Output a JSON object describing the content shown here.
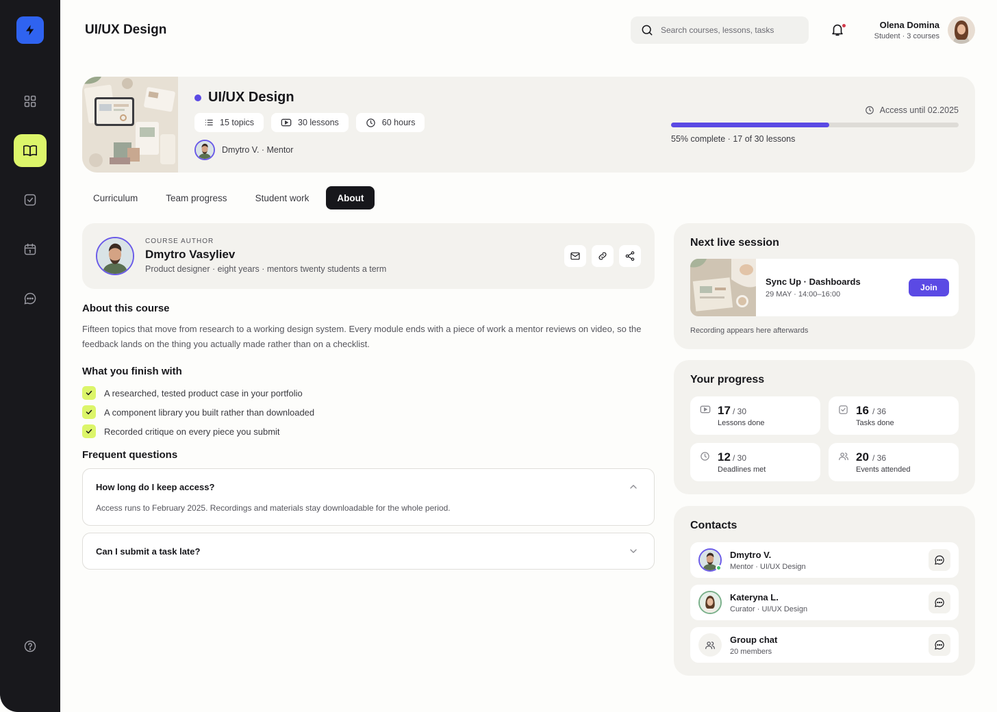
{
  "header": {
    "title": "UI/UX Design",
    "search_placeholder": "Search courses, lessons, tasks",
    "user_name": "Olena Domina",
    "user_sub": "Student · 3 courses"
  },
  "course": {
    "title": "UI/UX Design",
    "topics": "15 topics",
    "lessons": "30 lessons",
    "hours": "60 hours",
    "mentor": "Dmytro V. · Mentor",
    "access": "Access until 02.2025",
    "progress_fraction": 0.55,
    "progress_text": "55% complete · 17 of 30 lessons"
  },
  "tabs": [
    {
      "label": "Curriculum"
    },
    {
      "label": "Team progress"
    },
    {
      "label": "Student work"
    },
    {
      "label": "About",
      "active": true
    }
  ],
  "author": {
    "kicker": "COURSE AUTHOR",
    "name": "Dmytro Vasyliev",
    "desc": "Product designer · eight years · mentors twenty students a term"
  },
  "about": {
    "heading": "About this course",
    "body": "Fifteen topics that move from research to a working design system. Every module ends with a piece of work a mentor reviews on video, so the feedback lands on the thing you actually made rather than on a checklist."
  },
  "finish": {
    "heading": "What you finish with",
    "items": [
      "A researched, tested product case in your portfolio",
      "A component library you built rather than downloaded",
      "Recorded critique on every piece you submit"
    ]
  },
  "faq": {
    "heading": "Frequent questions",
    "items": [
      {
        "q": "How long do I keep access?",
        "a": "Access runs to February 2025. Recordings and materials stay downloadable for the whole period."
      },
      {
        "q": "Can I submit a task late?",
        "a": ""
      }
    ]
  },
  "session": {
    "heading": "Next live session",
    "name": "Sync Up · Dashboards",
    "time": "29 MAY · 14:00–16:00",
    "join": "Join",
    "note": "Recording appears here afterwards"
  },
  "progress": {
    "heading": "Your progress",
    "stats": [
      {
        "value": "17",
        "total": "/ 30",
        "label": "Lessons done",
        "icon": "video-icon"
      },
      {
        "value": "16",
        "total": "/ 36",
        "label": "Tasks done",
        "icon": "checkbox-icon"
      },
      {
        "value": "12",
        "total": "/ 30",
        "label": "Deadlines met",
        "icon": "clock-icon"
      },
      {
        "value": "20",
        "total": "/ 36",
        "label": "Events attended",
        "icon": "people-icon"
      }
    ]
  },
  "contacts": {
    "heading": "Contacts",
    "items": [
      {
        "name": "Dmytro V.",
        "role": "Mentor · UI/UX Design"
      },
      {
        "name": "Kateryna L.",
        "role": "Curator · UI/UX Design"
      },
      {
        "name": "Group chat",
        "role": "20 members"
      }
    ]
  },
  "colors": {
    "sidebar": "#18181c",
    "accent_lime": "#dcf56a",
    "accent_violet": "#5b4ae4",
    "logo_blue": "#2f63f0"
  }
}
